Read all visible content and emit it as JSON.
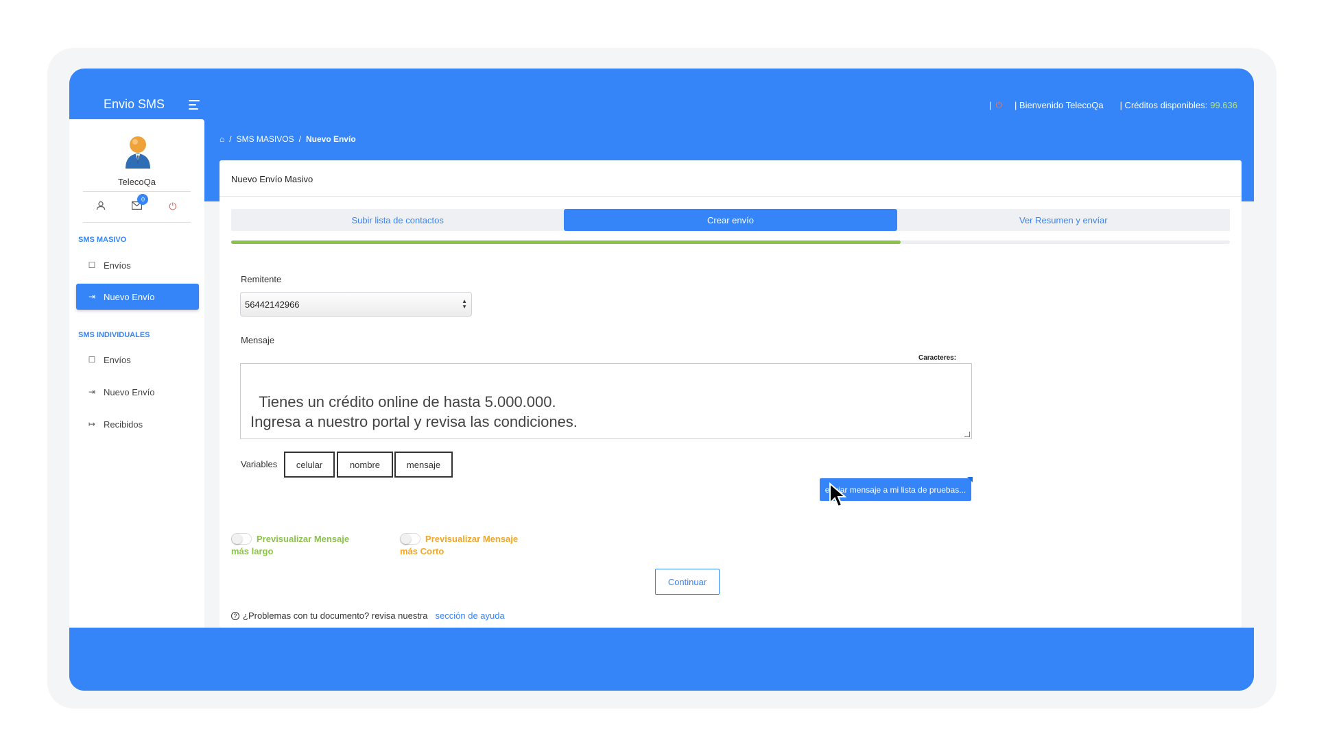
{
  "app": {
    "title": "Envio SMS"
  },
  "header": {
    "welcome": "| Bienvenido TelecoQa",
    "credits_label": "| Créditos disponibles:",
    "credits_value": "99.636"
  },
  "sidebar": {
    "user_name": "TelecoQa",
    "mail_badge": "0",
    "section_masivo": "SMS MASIVO",
    "masivo_items": [
      "Envíos",
      "Nuevo Envío"
    ],
    "section_individuales": "SMS INDIVIDUALES",
    "individual_items": [
      "Envíos",
      "Nuevo Envío",
      "Recibidos"
    ]
  },
  "breadcrumb": {
    "level1": "SMS MASIVOS",
    "level2": "Nuevo Envío"
  },
  "card": {
    "title": "Nuevo Envío Masivo",
    "tabs": [
      "Subir lista de contactos",
      "Crear envío",
      "Ver Resumen y envíar"
    ],
    "active_tab": 1,
    "progress_fraction": 0.67
  },
  "form": {
    "remitente_label": "Remitente",
    "remitente_value": "56442142966",
    "mensaje_label": "Mensaje",
    "counter_label": "Caracteres:",
    "message_text": "Tienes un crédito online de hasta 5.000.000.\nIngresa a nuestro portal y revisa las condiciones.",
    "variables_label": "Variables",
    "variables": [
      "celular",
      "nombre",
      "mensaje"
    ],
    "test_button": "enviar mensaje a mi lista de pruebas...",
    "preview_long": "Previsualizar Mensaje más largo",
    "preview_short": "Previsualizar Mensaje más Corto",
    "continue_button": "Continuar"
  },
  "help": {
    "text": "¿Problemas con tu documento? revisa nuestra",
    "link": "sección de ayuda"
  },
  "colors": {
    "primary": "#3585f8",
    "progress": "#8bc34a",
    "preview_long": "#8bc34a",
    "preview_short": "#f5a623",
    "credits": "#b6e37a"
  }
}
